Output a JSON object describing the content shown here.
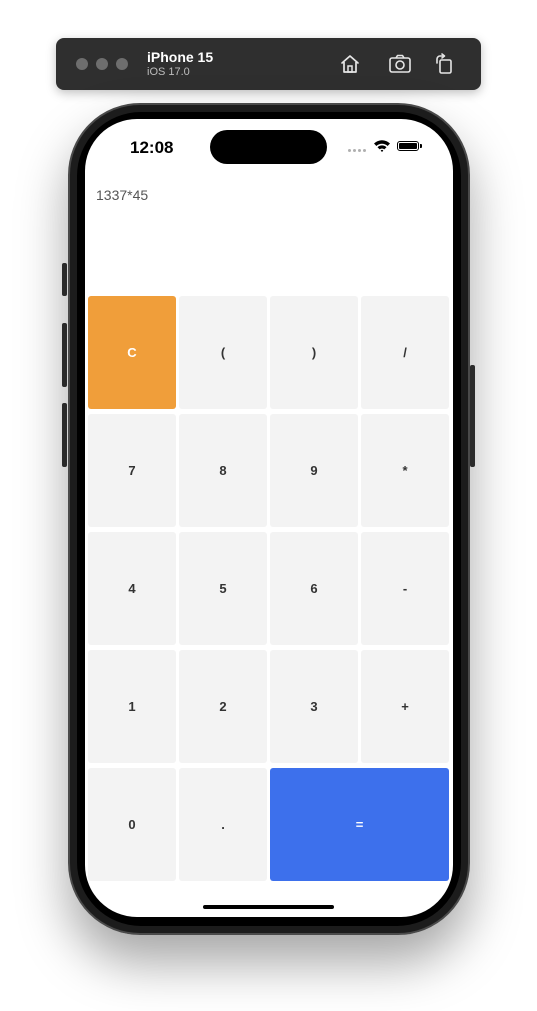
{
  "simulator": {
    "device_name": "iPhone 15",
    "os_version": "iOS 17.0",
    "icons": [
      "home-icon",
      "screenshot-icon",
      "rotate-icon"
    ]
  },
  "status_bar": {
    "time": "12:08"
  },
  "calculator": {
    "expression": "1337*45",
    "keys": {
      "clear": "C",
      "open_paren": "(",
      "close_paren": ")",
      "divide": "/",
      "seven": "7",
      "eight": "8",
      "nine": "9",
      "multiply": "*",
      "four": "4",
      "five": "5",
      "six": "6",
      "minus": "-",
      "one": "1",
      "two": "2",
      "three": "3",
      "plus": "+",
      "zero": "0",
      "decimal": ".",
      "equals": "="
    }
  },
  "colors": {
    "clear_key": "#f09e3a",
    "equals_key": "#3d70ec",
    "key_background": "#f3f3f3"
  }
}
